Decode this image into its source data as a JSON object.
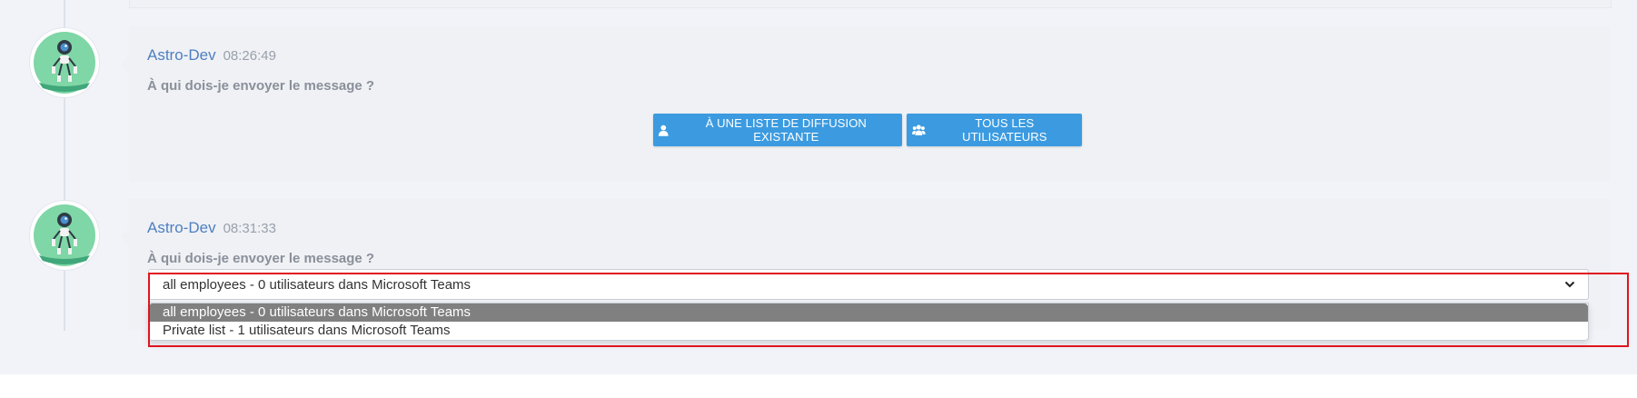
{
  "messages": [
    {
      "author": "Astro-Dev",
      "time": "08:26:49",
      "text": "À qui dois-je envoyer le message ?",
      "buttons": [
        {
          "label": "À UNE LISTE DE DIFFUSION EXISTANTE",
          "icon": "user-icon"
        },
        {
          "label": "TOUS LES UTILISATEURS",
          "icon": "users-icon"
        }
      ]
    },
    {
      "author": "Astro-Dev",
      "time": "08:31:33",
      "text": "À qui dois-je envoyer le message ?",
      "select": {
        "value": "all employees - 0 utilisateurs dans Microsoft Teams",
        "options": [
          "all employees - 0 utilisateurs dans Microsoft Teams",
          "Private list - 1 utilisateurs dans Microsoft Teams"
        ]
      }
    }
  ],
  "colors": {
    "accent": "#3c9be0",
    "author": "#4e7fc0",
    "highlight": "#e0141e",
    "avatar_green": "#7fd6a6"
  }
}
